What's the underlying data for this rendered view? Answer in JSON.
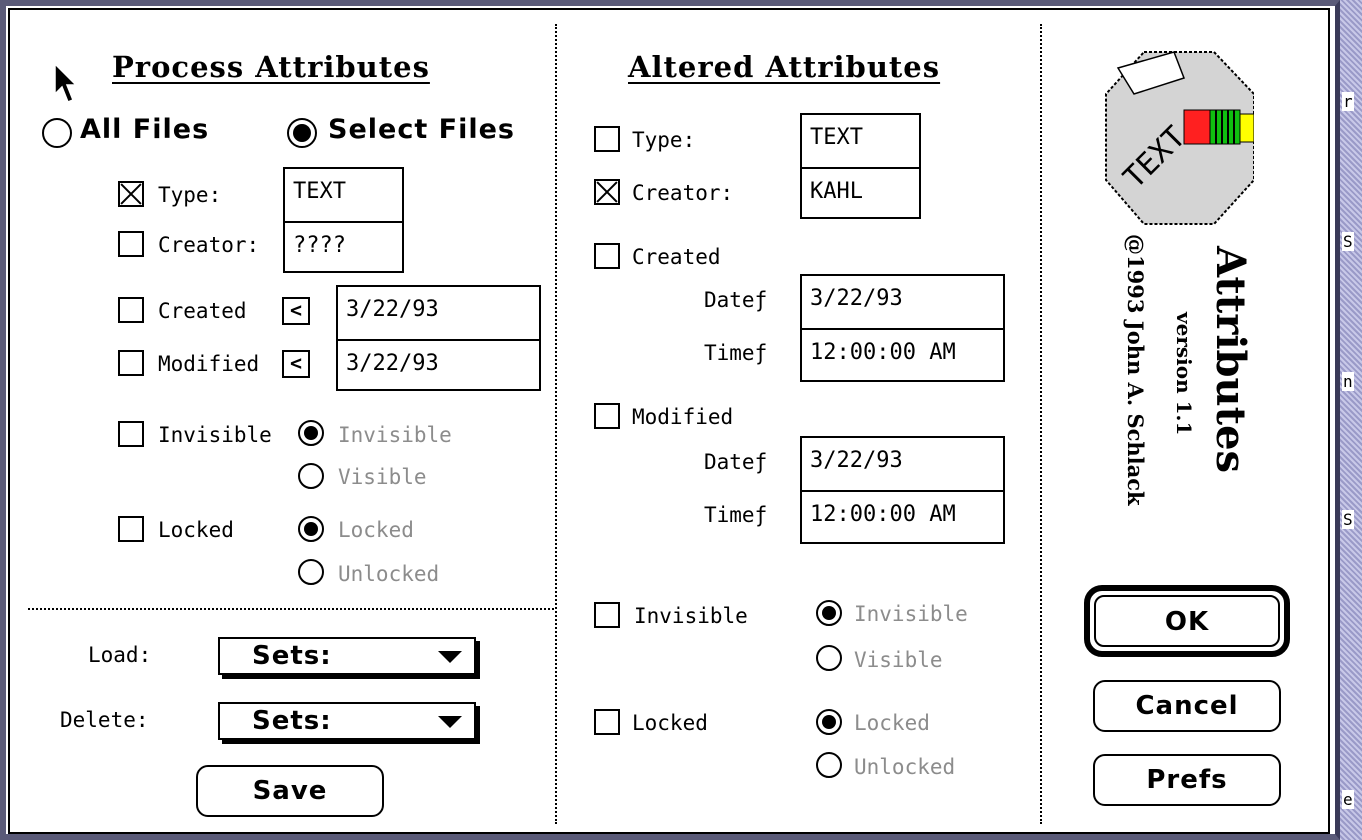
{
  "process": {
    "heading": "Process Attributes",
    "scope_all": "All Files",
    "scope_select": "Select Files",
    "type_label": "Type:",
    "type_value": "TEXT",
    "creator_label": "Creator:",
    "creator_value": "????",
    "created_label": "Created",
    "created_op": "<",
    "created_value": "3/22/93",
    "modified_label": "Modified",
    "modified_op": "<",
    "modified_value": "3/22/93",
    "invisible_label": "Invisible",
    "invisible_opt": "Invisible",
    "visible_opt": "Visible",
    "locked_label": "Locked",
    "locked_opt": "Locked",
    "unlocked_opt": "Unlocked"
  },
  "sets": {
    "load_label": "Load:",
    "load_value": "Sets:",
    "delete_label": "Delete:",
    "delete_value": "Sets:",
    "save_label": "Save"
  },
  "altered": {
    "heading": "Altered Attributes",
    "type_label": "Type:",
    "type_value": "TEXT",
    "creator_label": "Creator:",
    "creator_value": "KAHL",
    "created_label": "Created",
    "created_date_label": "Dateƒ",
    "created_date_value": "3/22/93",
    "created_time_label": "Timeƒ",
    "created_time_value": "12:00:00 AM",
    "modified_label": "Modified",
    "modified_date_label": "Dateƒ",
    "modified_date_value": "3/22/93",
    "modified_time_label": "Timeƒ",
    "modified_time_value": "12:00:00 AM",
    "invisible_label": "Invisible",
    "invisible_opt": "Invisible",
    "visible_opt": "Visible",
    "locked_label": "Locked",
    "locked_opt": "Locked",
    "unlocked_opt": "Unlocked"
  },
  "about": {
    "logo_text": "TEXT",
    "app_name": "Attributes",
    "version": "version 1.1",
    "copyright": "@1993 John A. Schlack"
  },
  "buttons": {
    "ok": "OK",
    "cancel": "Cancel",
    "prefs": "Prefs"
  },
  "background_window": {
    "fragments": [
      "r",
      "S",
      "n",
      "S",
      "e"
    ]
  },
  "colors": {
    "logo_red": "#ff2020",
    "logo_green": "#10c010",
    "logo_yellow": "#ffff00",
    "window_frame": "#5a5a78"
  }
}
